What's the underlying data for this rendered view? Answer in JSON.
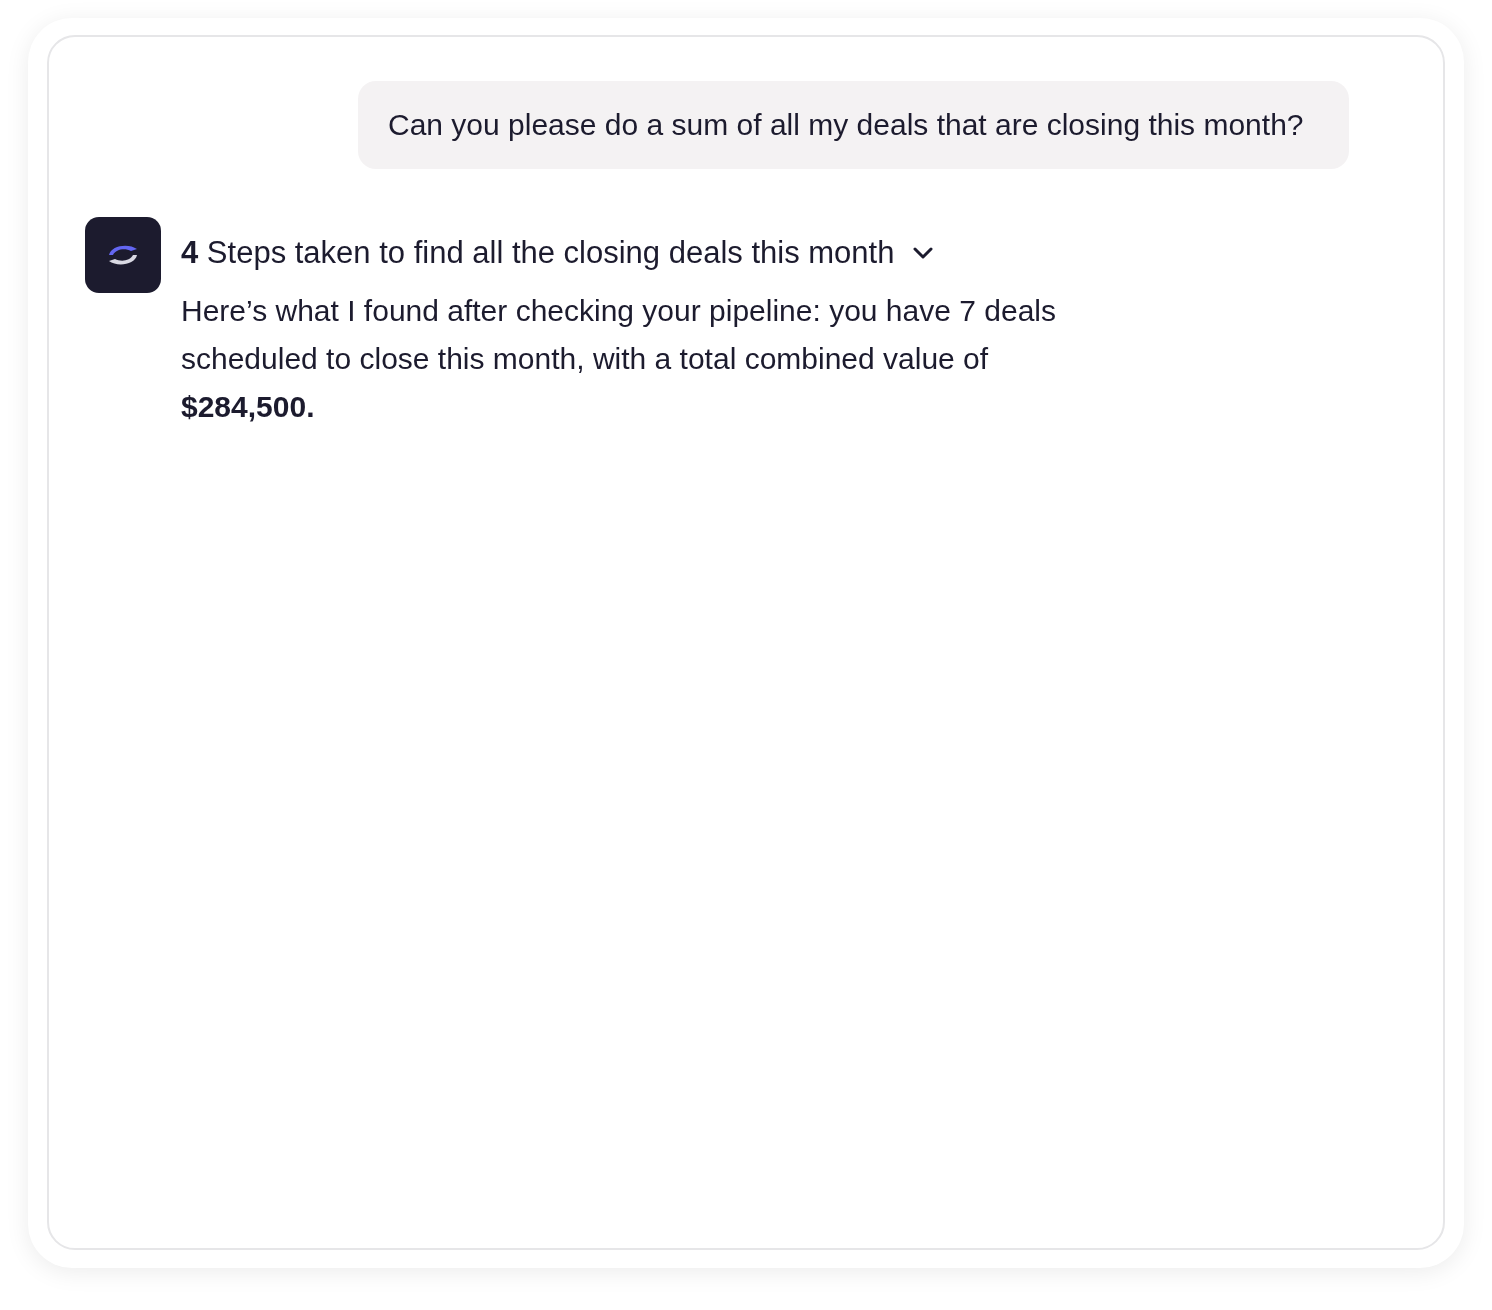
{
  "messages": [
    {
      "kind": "user",
      "text": "Can you please do a sum of all my deals that are closing this month?"
    },
    {
      "kind": "assistant",
      "steps": {
        "label": "**4** Steps taken to find all the closing deals this month",
        "expanded": false
      },
      "text": "Here’s what I found after checking your pipeline: you have 7 deals scheduled to close this month, with a total combined value of **$284,500.**"
    }
  ]
}
